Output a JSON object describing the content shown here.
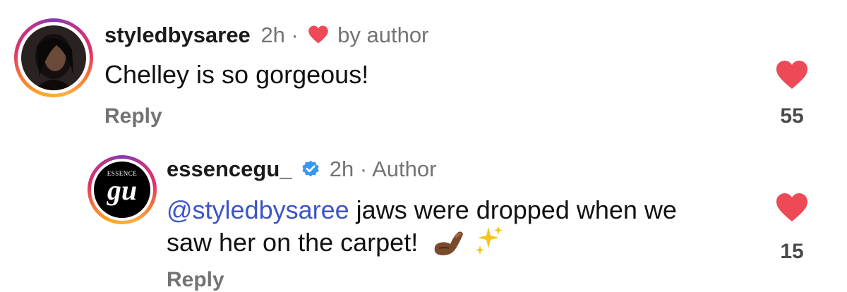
{
  "comments": [
    {
      "username": "styledbysaree",
      "time": "2h",
      "separator": "·",
      "tag": "by author",
      "text": "Chelley is so gorgeous!",
      "reply_label": "Reply",
      "like_count": "55",
      "liked_by_author": true
    },
    {
      "username": "essencegu_",
      "time": "2h",
      "separator": "·",
      "tag": "Author",
      "verified": true,
      "mention": "@styledbysaree",
      "text_line1": " jaws were dropped when we",
      "text_line2": "saw her on the carpet!",
      "emojis": [
        "pinching-hand-icon",
        "sparkles-icon"
      ],
      "reply_label": "Reply",
      "like_count": "15",
      "avatar_logo_top": "ESSENCE",
      "avatar_logo_main": "gu"
    }
  ],
  "colors": {
    "heart": "#ed4956",
    "mention": "#3c54c8",
    "verified": "#3897f0",
    "secondary_text": "#737373"
  }
}
